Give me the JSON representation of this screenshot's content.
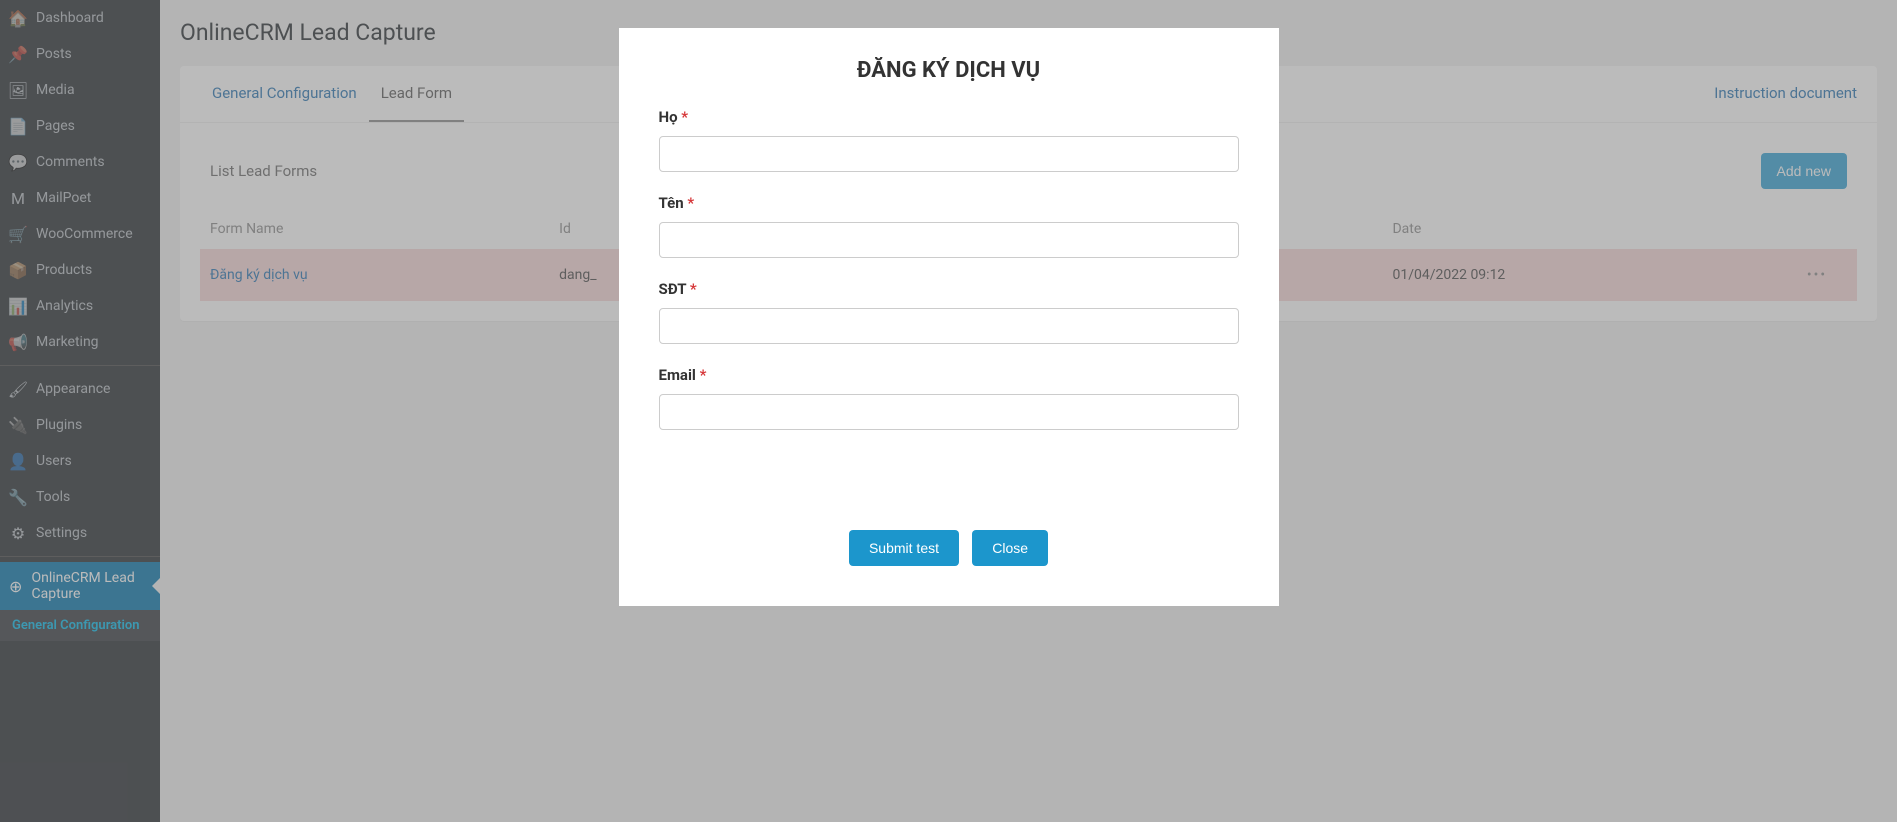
{
  "sidebar": {
    "items": [
      {
        "label": "Dashboard",
        "icon": "🏠"
      },
      {
        "label": "Posts",
        "icon": "📌"
      },
      {
        "label": "Media",
        "icon": "🖼"
      },
      {
        "label": "Pages",
        "icon": "📄"
      },
      {
        "label": "Comments",
        "icon": "💬"
      },
      {
        "label": "MailPoet",
        "icon": "M"
      },
      {
        "label": "WooCommerce",
        "icon": "🛒"
      },
      {
        "label": "Products",
        "icon": "📦"
      },
      {
        "label": "Analytics",
        "icon": "📊"
      },
      {
        "label": "Marketing",
        "icon": "📢"
      },
      {
        "label": "Appearance",
        "icon": "🖌"
      },
      {
        "label": "Plugins",
        "icon": "🔌"
      },
      {
        "label": "Users",
        "icon": "👤"
      },
      {
        "label": "Tools",
        "icon": "🔧"
      },
      {
        "label": "Settings",
        "icon": "⚙"
      },
      {
        "label": "OnlineCRM Lead Capture",
        "icon": "⊕"
      }
    ],
    "sub_active": "General Configuration"
  },
  "page": {
    "title": "OnlineCRM Lead Capture"
  },
  "tabs": {
    "general": "General Configuration",
    "lead_form": "Lead Form",
    "instruction": "Instruction document"
  },
  "list": {
    "title": "List Lead Forms",
    "add_button": "Add new",
    "columns": {
      "form_name": "Form Name",
      "id": "Id",
      "date": "Date"
    },
    "rows": [
      {
        "form_name": "Đăng ký dịch vụ",
        "id": "dang_",
        "date": "01/04/2022 09:12"
      }
    ]
  },
  "modal": {
    "title": "ĐĂNG KÝ DỊCH VỤ",
    "fields": {
      "ho": "Họ",
      "ten": "Tên",
      "sdt": "SĐT",
      "email": "Email"
    },
    "submit": "Submit test",
    "close": "Close"
  }
}
